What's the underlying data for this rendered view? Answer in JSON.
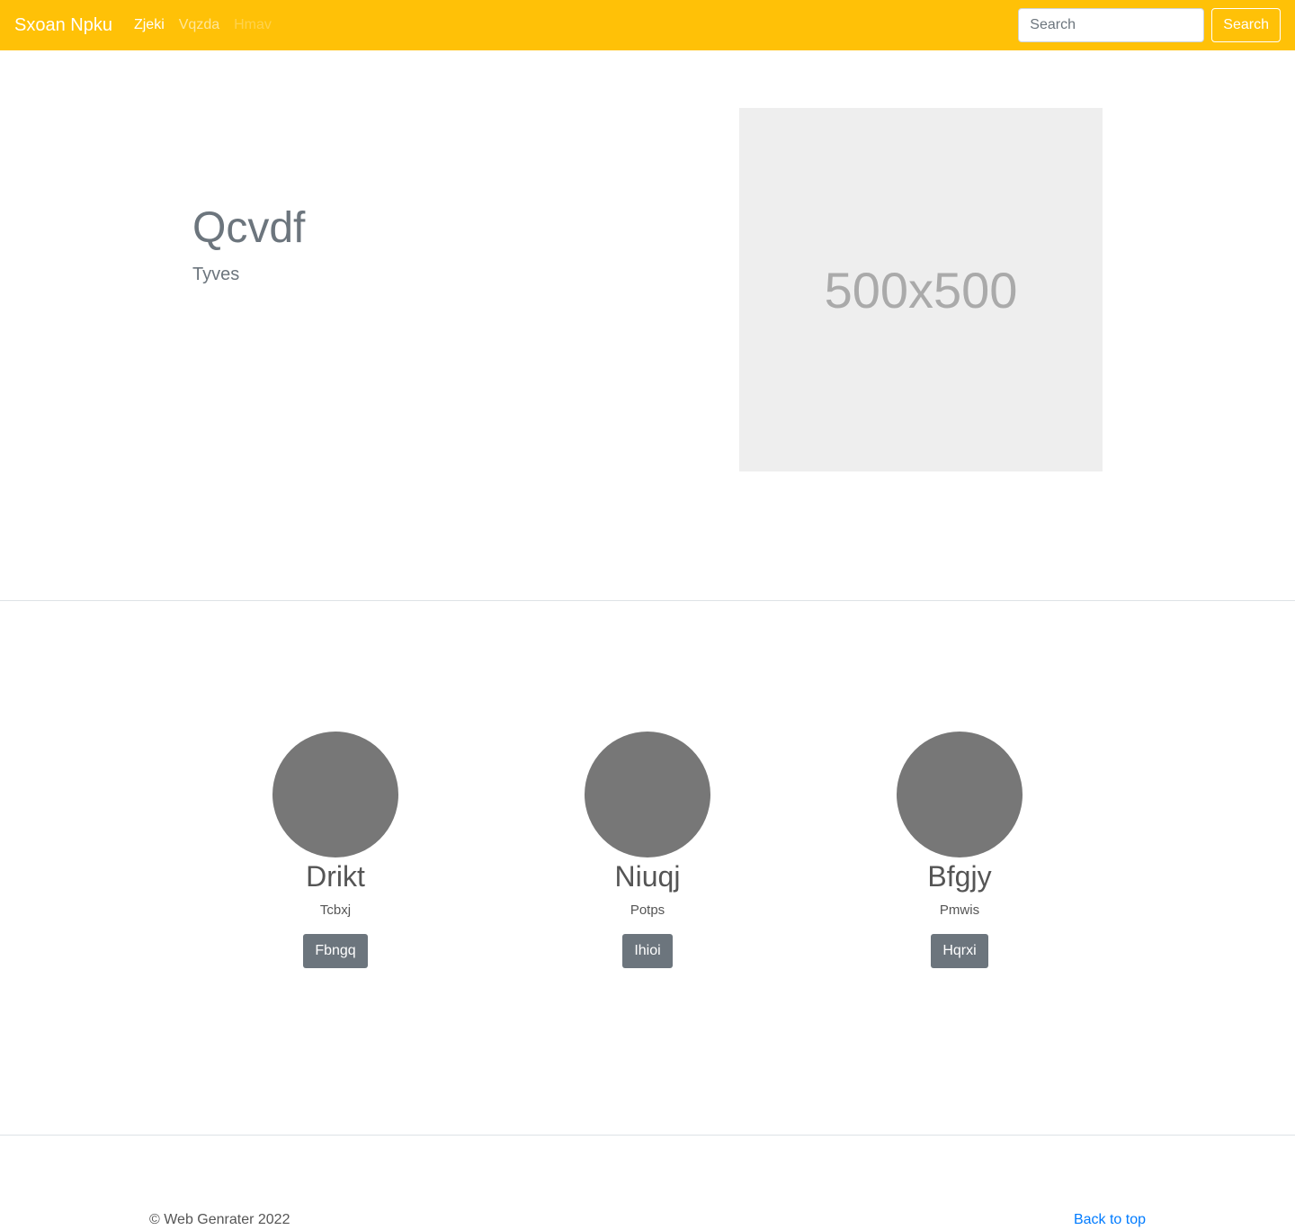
{
  "navbar": {
    "brand": "Sxoan Npku",
    "links": [
      {
        "label": "Zjeki",
        "state": "active"
      },
      {
        "label": "Vqzda",
        "state": "normal"
      },
      {
        "label": "Hmav",
        "state": "disabled"
      }
    ],
    "search": {
      "placeholder": "Search",
      "value": "",
      "button_label": "Search"
    },
    "background_color": "#ffc107"
  },
  "hero": {
    "title": "Qcvdf",
    "subtitle": "Tyves",
    "image_label": "500x500"
  },
  "team": {
    "members": [
      {
        "name": "Drikt",
        "role": "Tcbxj",
        "button_label": "Fbngq"
      },
      {
        "name": "Niuqj",
        "role": "Potps",
        "button_label": "Ihioi"
      },
      {
        "name": "Bfgjy",
        "role": "Pmwis",
        "button_label": "Hqrxi"
      }
    ]
  },
  "footer": {
    "copyright": "© Web Genrater 2022",
    "back_to_top": "Back to top"
  }
}
